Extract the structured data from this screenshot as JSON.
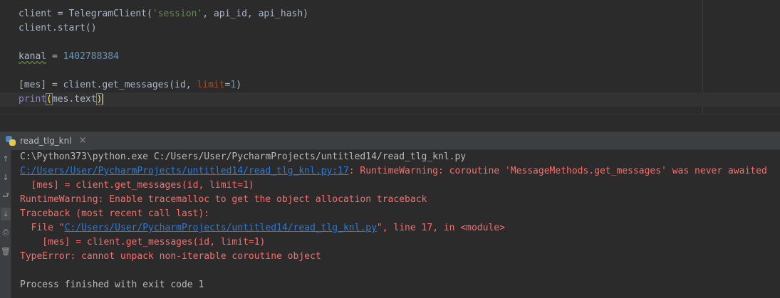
{
  "editor": {
    "line1": {
      "a": "client = TelegramClient(",
      "str": "'session'",
      "b": ", api_id, api_hash)"
    },
    "line2": {
      "text": "client.start()"
    },
    "line4": {
      "var": "kanal",
      "op": " = ",
      "num": "1402788384"
    },
    "line6": {
      "a": "[mes] = client.get_messages(id, ",
      "kw": "limit",
      "eq": "=",
      "num": "1",
      "close": ")"
    },
    "line7": {
      "builtin": "print",
      "open": "(",
      "mid": "mes.text",
      "close": ")"
    }
  },
  "run": {
    "tab_label": "read_tlg_knl",
    "toolbar_icons": [
      "arrow-up-icon",
      "arrow-down-icon",
      "soft-wrap-icon",
      "scroll-to-end-icon",
      "print-icon",
      "trash-icon"
    ],
    "console": {
      "cmd": "C:\\Python373\\python.exe C:/Users/User/PycharmProjects/untitled14/read_tlg_knl.py",
      "warn_link": "C:/Users/User/PycharmProjects/untitled14/read_tlg_knl.py:17",
      "warn_text": ": RuntimeWarning: coroutine 'MessageMethods.get_messages' was never awaited",
      "warn_code": "  [mes] = client.get_messages(id, limit=1)",
      "tracemalloc": "RuntimeWarning: Enable tracemalloc to get the object allocation traceback",
      "traceback": "Traceback (most recent call last):",
      "file_prefix": "  File \"",
      "file_link": "C:/Users/User/PycharmProjects/untitled14/read_tlg_knl.py",
      "file_suffix": "\", line 17, in <module>",
      "tb_code": "    [mes] = client.get_messages(id, limit=1)",
      "type_error": "TypeError: cannot unpack non-iterable coroutine object",
      "exit": "Process finished with exit code 1"
    }
  }
}
